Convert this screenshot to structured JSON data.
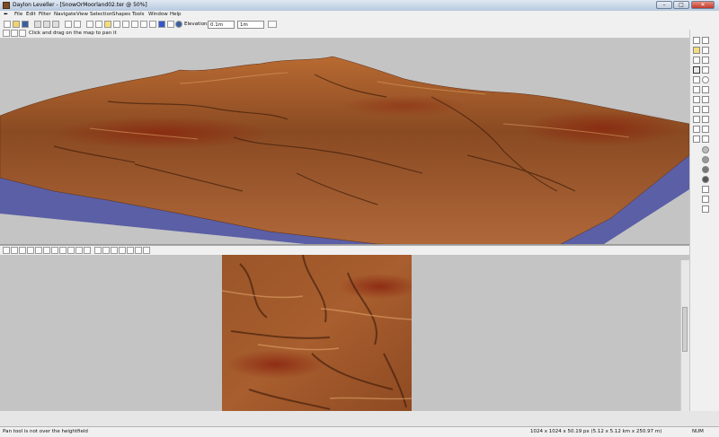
{
  "window": {
    "title": "Daylon Leveller - [SnowOrMoorland02.ter @ 50%]",
    "minimize": "–",
    "maximize": "□",
    "close": "✕"
  },
  "menu": [
    "File",
    "Edit",
    "Filter",
    "Navigate",
    "View",
    "Selection",
    "Shapes",
    "Tools",
    "Window",
    "Help"
  ],
  "toolbar": {
    "elevations_label": "Elevations:",
    "elevation_min": "0.1m",
    "elevation_max": "1m"
  },
  "hint": "Click and drag on the map to pan it",
  "status": {
    "left": "Pan tool is not over the heightfield",
    "size": "1024 x 1024 x 50.19 px (5.12 x 5.12 km x 250.97 m)",
    "num": "NUM"
  },
  "colors": {
    "terrain_dark": "#4a2410",
    "terrain_mid": "#9a5424",
    "terrain_light": "#d7965a",
    "water": "#5a5fa6",
    "background": "#c4c4c4"
  },
  "icons": [
    "new-icon",
    "open-icon",
    "save-icon",
    "undo-icon",
    "redo-icon",
    "pan-icon",
    "zoom-icon",
    "brush-icon",
    "info-icon"
  ]
}
